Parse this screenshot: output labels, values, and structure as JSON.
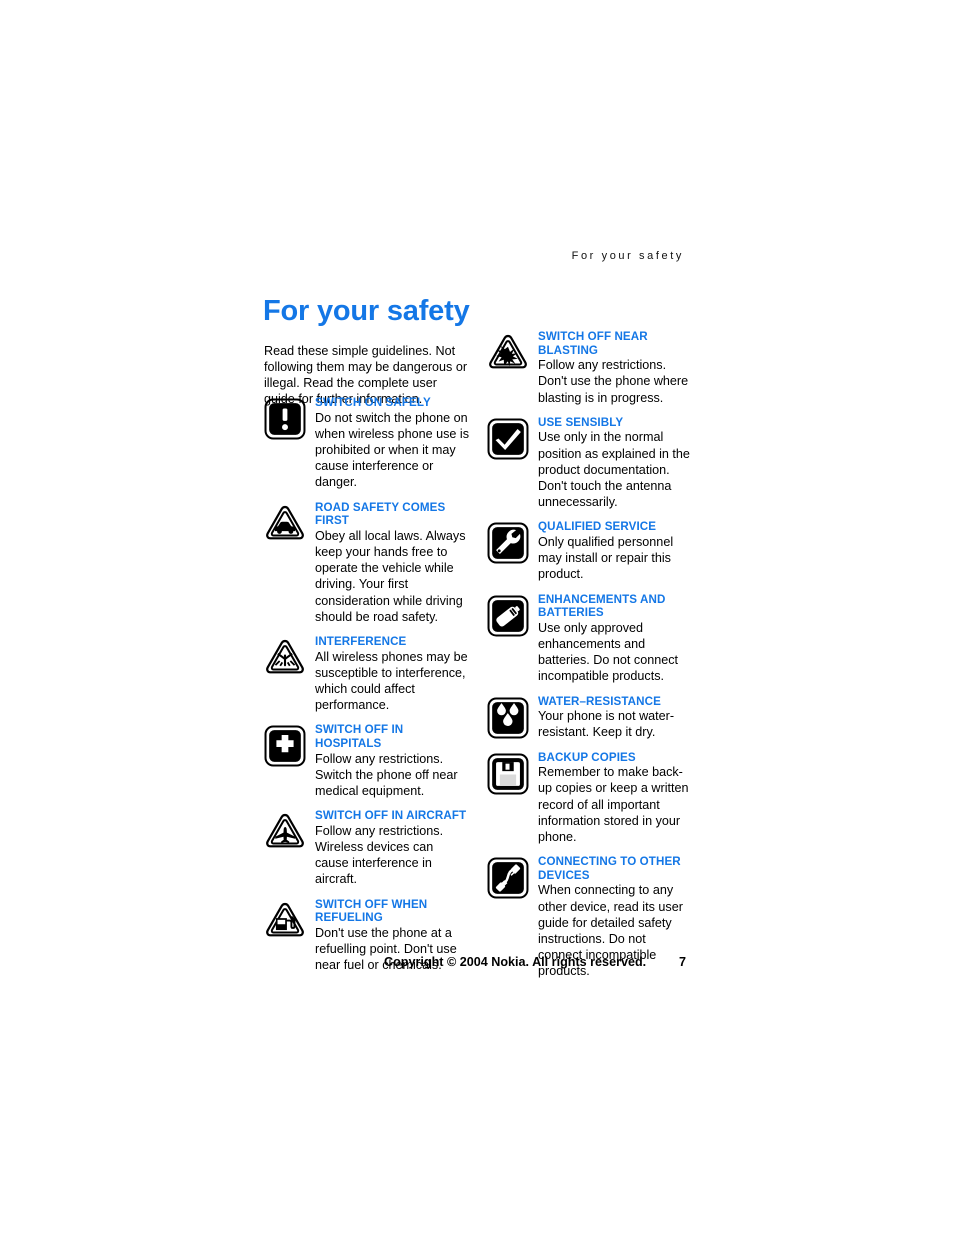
{
  "running_header": "For your safety",
  "title": "For your safety",
  "intro": "Read these simple guidelines. Not following them may be dangerous or illegal. Read the complete user guide for further information.",
  "accent_color": "#1477e6",
  "icon_color": "#000000",
  "left_column": [
    {
      "icon": "exclamation-square-icon",
      "icon_shape": "square",
      "title": "SWITCH ON SAFELY",
      "text": "Do not switch the phone on when wireless phone use is prohibited or when it may cause interference or danger."
    },
    {
      "icon": "car-triangle-icon",
      "icon_shape": "triangle",
      "title": "ROAD SAFETY COMES FIRST",
      "text": "Obey all local laws. Always keep your hands free to operate the vehicle while driving. Your first consideration while driving should be road safety."
    },
    {
      "icon": "interference-triangle-icon",
      "icon_shape": "triangle",
      "title": "INTERFERENCE",
      "text": "All wireless phones may be susceptible to interference, which could affect performance."
    },
    {
      "icon": "hospital-cross-square-icon",
      "icon_shape": "square",
      "title": "SWITCH OFF IN HOSPITALS",
      "text": "Follow any restrictions. Switch the phone off near medical equipment."
    },
    {
      "icon": "aircraft-triangle-icon",
      "icon_shape": "triangle",
      "title": "SWITCH OFF IN AIRCRAFT",
      "text": "Follow any restrictions. Wireless devices can cause interference in aircraft."
    },
    {
      "icon": "fuel-pump-triangle-icon",
      "icon_shape": "triangle",
      "title": "SWITCH OFF WHEN REFUELING",
      "text": "Don't use the phone at a refuelling point. Don't use near fuel or chemicals."
    }
  ],
  "right_column": [
    {
      "icon": "blasting-triangle-icon",
      "icon_shape": "triangle",
      "title": "SWITCH OFF NEAR BLASTING",
      "text": "Follow any restrictions. Don't use the phone where blasting is in progress."
    },
    {
      "icon": "checkmark-square-icon",
      "icon_shape": "square",
      "title": "USE SENSIBLY",
      "text": "Use only in the normal position as explained in the product documentation. Don't touch the antenna unnecessarily."
    },
    {
      "icon": "wrench-square-icon",
      "icon_shape": "square",
      "title": "QUALIFIED SERVICE",
      "text": "Only qualified personnel may install or repair this product."
    },
    {
      "icon": "battery-square-icon",
      "icon_shape": "square",
      "title": "ENHANCEMENTS AND BATTERIES",
      "text": "Use only approved enhancements and batteries. Do not connect incompatible products."
    },
    {
      "icon": "water-drops-square-icon",
      "icon_shape": "square",
      "title": "WATER–RESISTANCE",
      "text": "Your phone is not water-resistant. Keep it dry."
    },
    {
      "icon": "floppy-disk-square-icon",
      "icon_shape": "square",
      "title": "BACKUP COPIES",
      "text": "Remember to make back-up copies or keep a written record of all important information stored in your phone."
    },
    {
      "icon": "connector-plugs-square-icon",
      "icon_shape": "square",
      "title": "CONNECTING TO OTHER DEVICES",
      "text": "When connecting to any other device, read its user guide for detailed safety instructions. Do not connect incompatible products."
    }
  ],
  "footer": {
    "copyright": "Copyright © 2004 Nokia. All rights reserved.",
    "page_number": "7"
  }
}
